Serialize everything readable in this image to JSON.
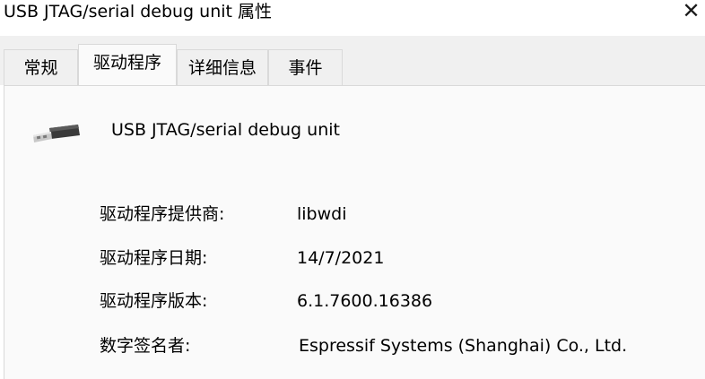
{
  "window": {
    "title": "USB JTAG/serial debug unit 属性",
    "close_label": "✕"
  },
  "tabs": [
    {
      "label": "常规",
      "active": false
    },
    {
      "label": "驱动程序",
      "active": true
    },
    {
      "label": "详细信息",
      "active": false
    },
    {
      "label": "事件",
      "active": false
    }
  ],
  "device": {
    "icon": "usb-plug-icon",
    "name": "USB JTAG/serial debug unit"
  },
  "details": [
    {
      "label": "驱动程序提供商:",
      "value": "libwdi"
    },
    {
      "label": "驱动程序日期:",
      "value": "14/7/2021"
    },
    {
      "label": "驱动程序版本:",
      "value": "6.1.7600.16386"
    },
    {
      "label": "数字签名者:",
      "value": "Espressif Systems (Shanghai) Co., Ltd."
    }
  ]
}
